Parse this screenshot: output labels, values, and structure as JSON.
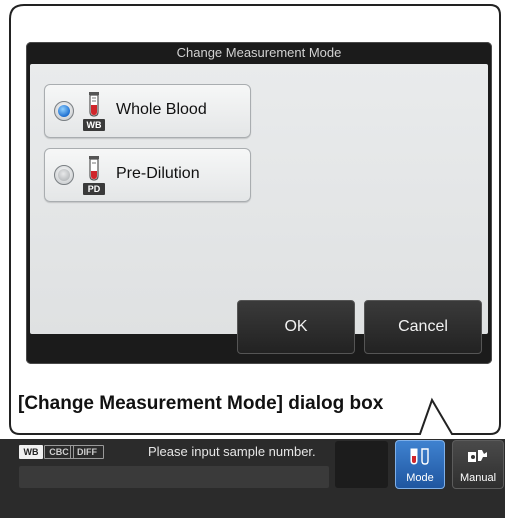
{
  "dialog": {
    "title": "Change Measurement Mode",
    "options": [
      {
        "label": "Whole Blood",
        "badge": "WB",
        "selected": true
      },
      {
        "label": "Pre-Dilution",
        "badge": "PD",
        "selected": false
      }
    ],
    "ok_label": "OK",
    "cancel_label": "Cancel"
  },
  "caption": "[Change Measurement Mode] dialog box",
  "statusbar": {
    "tags": [
      "WB",
      "CBC",
      "DIFF"
    ],
    "message": "Please input sample number.",
    "mode_button": {
      "label": "Mode",
      "icon": "test-tube-icon"
    },
    "manual_button": {
      "label": "Manual",
      "icon": "manual-icon"
    }
  },
  "colors": {
    "accent": "#1f6fd0",
    "tube_red": "#d0262b",
    "dialog_bg": "#1b1b1b"
  }
}
